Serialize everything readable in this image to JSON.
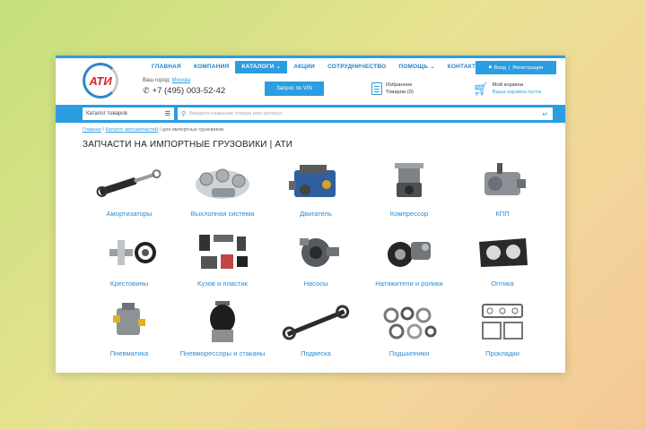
{
  "logo": {
    "text": "АТИ"
  },
  "nav": [
    "ГЛАВНАЯ",
    "КОМПАНИЯ",
    "КАТАЛОГИ ⌄",
    "АКЦИИ",
    "СОТРУДНИЧЕСТВО",
    "ПОМОЩЬ ⌄",
    "КОНТАКТЫ"
  ],
  "city": {
    "label": "Ваш город:",
    "value": "Москва"
  },
  "phone": "+7 (495) 003-52-42",
  "vin_button": "Запрос по VIN",
  "favorites": {
    "line1": "Избранное",
    "line2": "Товаров (0)"
  },
  "cart": {
    "line1": "Мой корзина",
    "line2": "Ваша корзина пуста"
  },
  "login": {
    "login": "Вход",
    "separator": "|",
    "register": "Регистрация"
  },
  "search": {
    "catalog_select": "Каталог товаров",
    "placeholder": "Введите название товара или артикул"
  },
  "breadcrumb": {
    "home": "Главная",
    "sep1": " / ",
    "catalog": "Каталог автозапчастей",
    "sep2": " / ",
    "current": "для импортных грузовиков"
  },
  "page_title": "ЗАПЧАСТИ НА ИМПОРТНЫЕ ГРУЗОВИКИ | АТИ",
  "categories": [
    {
      "label": "Амортизаторы",
      "icon": "shock-absorber-icon"
    },
    {
      "label": "Выхлопная система",
      "icon": "exhaust-system-icon"
    },
    {
      "label": "Двигатель",
      "icon": "engine-icon"
    },
    {
      "label": "Компрессор",
      "icon": "compressor-icon"
    },
    {
      "label": "КПП",
      "icon": "gearbox-icon"
    },
    {
      "label": "Крестовины",
      "icon": "cross-joint-icon"
    },
    {
      "label": "Кузов и пластик",
      "icon": "body-plastic-icon"
    },
    {
      "label": "Насосы",
      "icon": "pump-icon"
    },
    {
      "label": "Натяжители и ролики",
      "icon": "tensioner-icon"
    },
    {
      "label": "Оптика",
      "icon": "headlight-icon"
    },
    {
      "label": "Пневматика",
      "icon": "pneumatics-icon"
    },
    {
      "label": "Пневморессоры и стаканы",
      "icon": "air-spring-icon"
    },
    {
      "label": "Подвеска",
      "icon": "suspension-icon"
    },
    {
      "label": "Подшипники",
      "icon": "bearing-icon"
    },
    {
      "label": "Прокладки",
      "icon": "gasket-icon"
    }
  ],
  "colors": {
    "accent": "#2b9de0",
    "logo_red": "#d4262b"
  }
}
